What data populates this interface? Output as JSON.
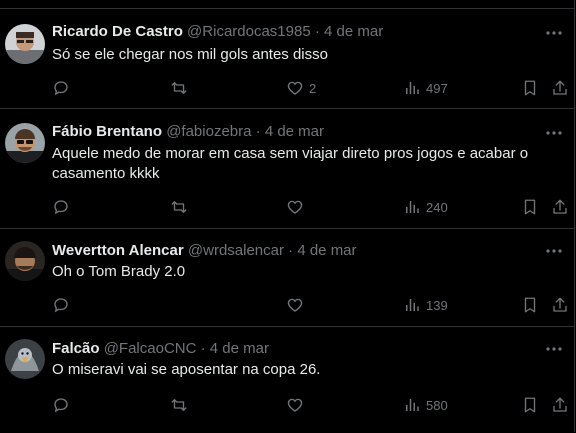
{
  "tweets": [
    {
      "name": "Ricardo De Castro",
      "handle": "@Ricardocas1985",
      "date": "4 de mar",
      "text": "Só se ele chegar nos mil gols antes disso",
      "likes": "2",
      "views": "497",
      "avatar": "avatar-ricardo"
    },
    {
      "name": "Fábio Brentano",
      "handle": "@fabiozebra",
      "date": "4 de mar",
      "text": "Aquele medo de morar em casa sem viajar direto pros jogos e acabar o casamento kkkk",
      "likes": "",
      "views": "240",
      "avatar": "avatar-fabio"
    },
    {
      "name": "Wevertton Alencar",
      "handle": "@wrdsalencar",
      "date": "4 de mar",
      "text": "Oh o Tom Brady 2.0",
      "likes": "",
      "views": "139",
      "avatar": "avatar-wevertton"
    },
    {
      "name": "Falcão",
      "handle": "@FalcaoCNC",
      "date": "4 de mar",
      "text": "O miseravi vai se aposentar na copa 26.",
      "likes": "",
      "views": "580",
      "avatar": "avatar-falcao"
    }
  ],
  "separator": "·",
  "colors": {
    "background": "#000000",
    "text": "#e7e9ea",
    "muted": "#71767b",
    "border": "#2f3336"
  },
  "icons": [
    "reply-icon",
    "retweet-icon",
    "like-icon",
    "views-icon",
    "bookmark-icon",
    "share-icon",
    "more-icon"
  ]
}
